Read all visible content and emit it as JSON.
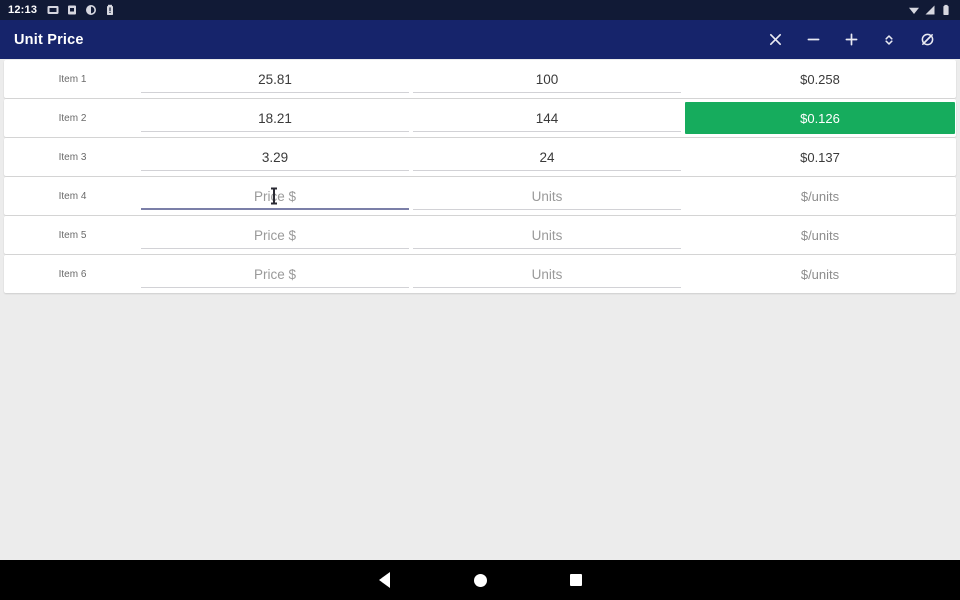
{
  "status_bar": {
    "clock": "12:13",
    "left_icons": [
      "screenshot-icon",
      "sim-card-icon",
      "clock-icon",
      "battery-alert-icon"
    ],
    "right_icons": [
      "wifi-icon",
      "cellular-signal-icon",
      "battery-icon"
    ]
  },
  "app_bar": {
    "title": "Unit Price",
    "actions": [
      {
        "name": "close-button",
        "icon": "close-icon"
      },
      {
        "name": "remove-row-button",
        "icon": "minus-icon"
      },
      {
        "name": "add-row-button",
        "icon": "plus-icon"
      },
      {
        "name": "sort-button",
        "icon": "sort-updown-icon"
      },
      {
        "name": "toggle-highlight-button",
        "icon": "highlight-off-icon"
      }
    ]
  },
  "table": {
    "columns": [
      "item",
      "price",
      "units",
      "unit_price"
    ],
    "placeholders": {
      "price": "Price $",
      "units": "Units",
      "unit_price": "$/units"
    },
    "rows": [
      {
        "item": "Item 1",
        "price": "25.81",
        "units": "100",
        "unit_price": "$0.258",
        "highlighted": false,
        "focused": false
      },
      {
        "item": "Item 2",
        "price": "18.21",
        "units": "144",
        "unit_price": "$0.126",
        "highlighted": true,
        "focused": false
      },
      {
        "item": "Item 3",
        "price": "3.29",
        "units": "24",
        "unit_price": "$0.137",
        "highlighted": false,
        "focused": false
      },
      {
        "item": "Item 4",
        "price": "",
        "units": "",
        "unit_price": "",
        "highlighted": false,
        "focused": true
      },
      {
        "item": "Item 5",
        "price": "",
        "units": "",
        "unit_price": "",
        "highlighted": false,
        "focused": false
      },
      {
        "item": "Item 6",
        "price": "",
        "units": "",
        "unit_price": "",
        "highlighted": false,
        "focused": false
      }
    ]
  },
  "nav_bar": {
    "back": "back-icon",
    "home": "home-icon",
    "recents": "recents-icon"
  },
  "colors": {
    "app_bar": "#16246b",
    "status_bar": "#111a36",
    "page_background": "#ececec",
    "row_background": "#ffffff",
    "highlight_green": "#16ac5d",
    "focus_underline": "#7b7fa8"
  }
}
